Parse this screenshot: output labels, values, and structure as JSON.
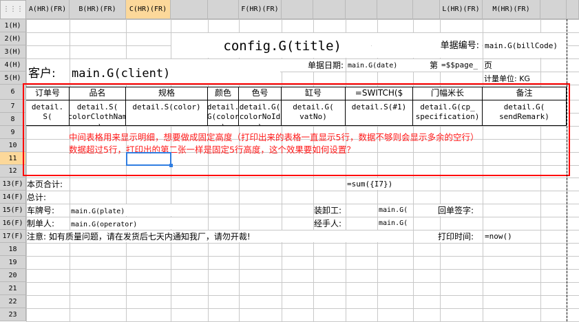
{
  "column_headers": {
    "corner": "⋮⋮⋮",
    "A": "A(HR)(FR)",
    "B": "B(HR)(FR)",
    "C": "C(HR)(FR)",
    "F": "F(HR)(FR)",
    "L": "L(HR)(FR)",
    "M": "M(HR)(FR)"
  },
  "row_headers": [
    "1(H)",
    "2(H)",
    "3(H)",
    "4(H)",
    "5(H)",
    "6",
    "7",
    "8",
    "9",
    "10",
    "11",
    "12",
    "13(F)",
    "14(F)",
    "15(F)",
    "16(F)",
    "17(F)",
    "18",
    "19",
    "20",
    "21",
    "22",
    "23"
  ],
  "header": {
    "title": "config.G(title)",
    "bill_code_label": "单据编号:",
    "bill_code": "main.G(billCode)",
    "client_label": "客户:",
    "client": "main.G(client)",
    "date_label": "单据日期:",
    "date": "main.G(date)",
    "page_prefix": "第",
    "page_formula": "=$$page_",
    "page_suffix": "页",
    "unit": "计量单位: KG"
  },
  "table": {
    "headers": [
      "订单号",
      "品名",
      "规格",
      "颜色",
      "色号",
      "缸号",
      "=SWITCH($",
      "门幅米长",
      "备注"
    ],
    "cells": [
      "detail.\nS(",
      "detail.S(\ncolorClothNam\ne)",
      "detail.S(color)",
      "detail.\nG(color\n)",
      "detail.G(\ncolorNoId\n)",
      "detail.G(\nvatNo)",
      "detail.S(#1)",
      "detail.G(cp_\nspecification)",
      "detail.G(\nsendRemark)"
    ]
  },
  "annotation": {
    "line1": "中间表格用来显示明细，想要做成固定高度（打印出来的表格一直显示5行，数据不够则会显示多余的空行）",
    "line2": "数据超过5行，打印出的第二张一样是固定5行高度，这个效果要如何设置？"
  },
  "footer": {
    "page_total_label": "本页合计:",
    "page_total": "=sum({I7})",
    "total_label": "总计:",
    "plate_label": "车牌号:",
    "plate": "main.G(plate)",
    "loader_label": "装卸工:",
    "loader": "main.G(",
    "receipt_label": "回单签字:",
    "maker_label": "制单人:",
    "maker": "main.G(operator)",
    "handler_label": "经手人:",
    "handler": "main.G(",
    "notice": "注意: 如有质量问题，请在发货后七天内通知我厂，请勿开裁!",
    "print_time_label": "打印时间:",
    "print_time": "=now()"
  },
  "colors": {
    "annotation": "#ff1a1a",
    "selection": "#2f7de1",
    "header_selected": "#fcd89a"
  }
}
